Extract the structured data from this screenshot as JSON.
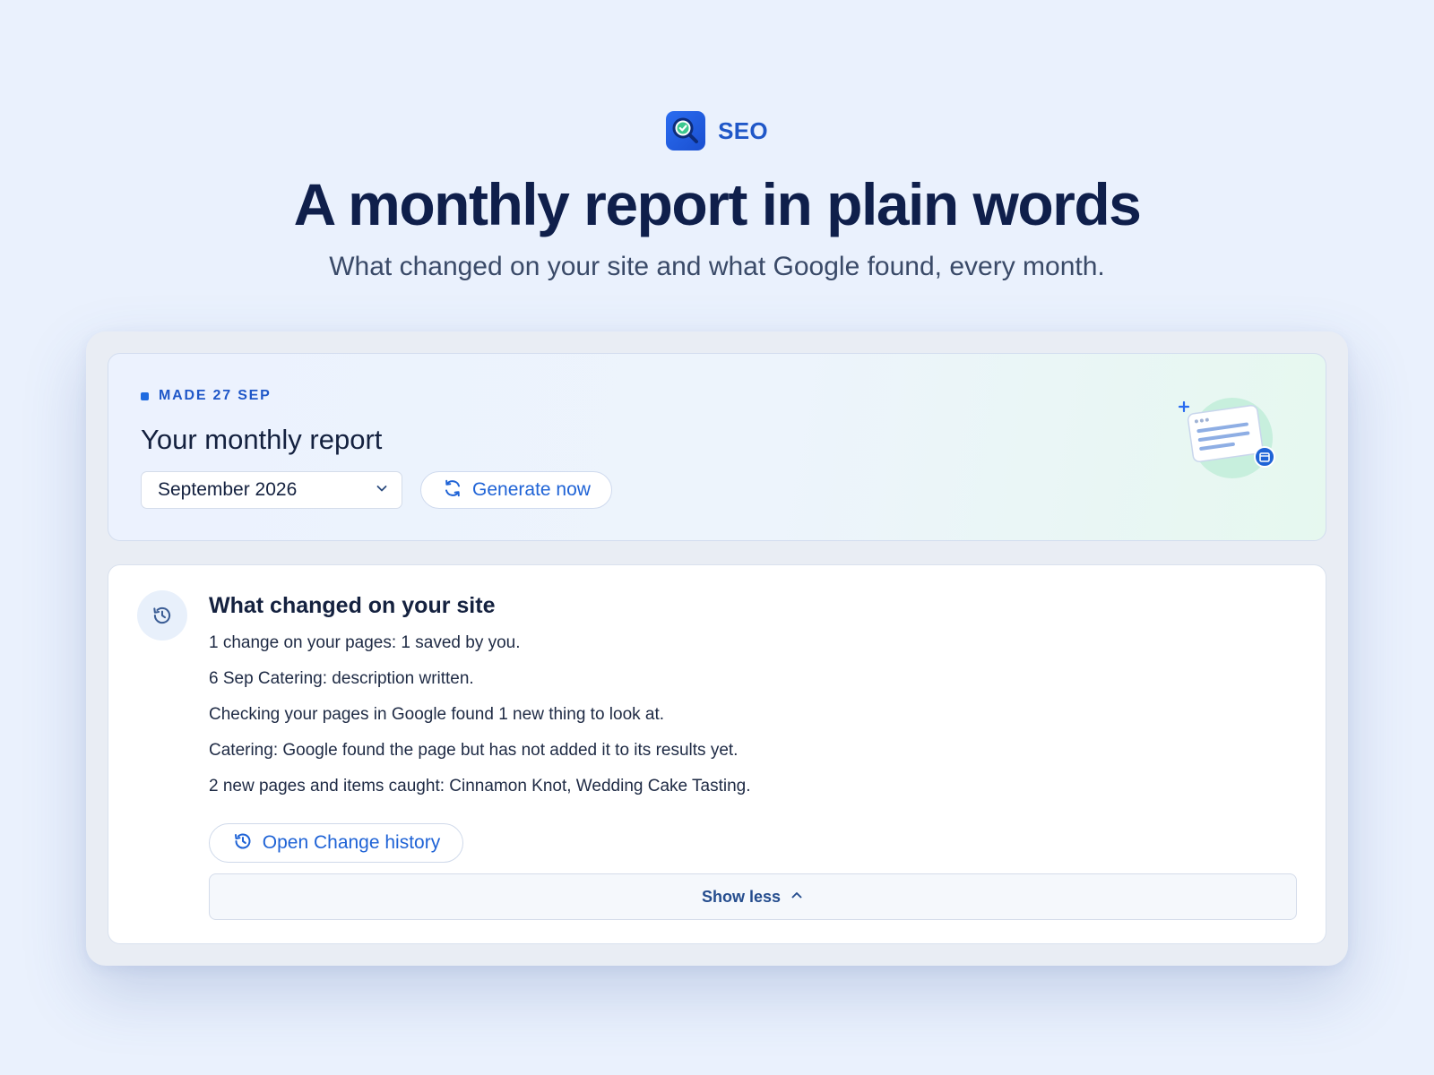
{
  "brand": {
    "name": "SEO",
    "icon": "search-check-icon",
    "color": "#2a6cf0"
  },
  "hero": {
    "title": "A monthly report in plain words",
    "subtitle": "What changed on your site and what Google found, every month."
  },
  "report": {
    "made_label": "MADE 27 SEP",
    "title": "Your monthly report",
    "month_select": {
      "value": "September 2026",
      "icon": "chevron-down-icon"
    },
    "generate_button": {
      "label": "Generate now",
      "icon": "refresh-icon"
    },
    "illustration": "report-calendar-illustration"
  },
  "changes": {
    "icon": "history-icon",
    "title": "What changed on your site",
    "lines": [
      "1 change on your pages: 1 saved by you.",
      "6 Sep Catering: description written.",
      "Checking your pages in Google found 1 new thing to look at.",
      "Catering: Google found the page but has not added it to its results yet.",
      "2 new pages and items caught: Cinnamon Knot, Wedding Cake Tasting."
    ],
    "open_history_button": {
      "label": "Open Change history",
      "icon": "history-icon"
    },
    "show_less_button": {
      "label": "Show less",
      "icon": "chevron-up-icon"
    }
  },
  "colors": {
    "accent": "#1f63d6",
    "background": "#eaf1fd",
    "heading": "#0f1f4b"
  }
}
